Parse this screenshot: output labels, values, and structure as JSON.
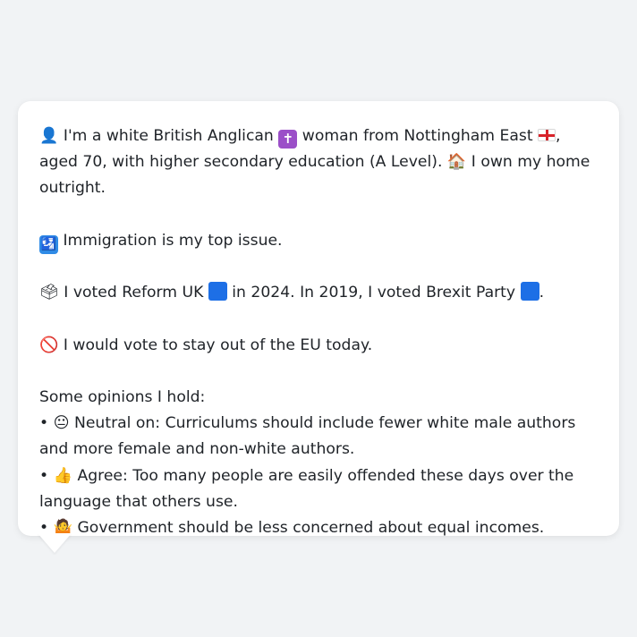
{
  "persona": {
    "intro": {
      "person_icon": "👤",
      "text1": "I'm a white British Anglican",
      "cross_icon": "✝",
      "text2": "woman from Nottingham East",
      "text3": ", aged 70, with higher secondary education (A Level).",
      "house_icon": "🏠",
      "text4": "I own my home outright."
    },
    "issue": {
      "icon": "🛂",
      "text": "Immigration is my top issue."
    },
    "vote": {
      "ballot_icon": "🗳",
      "text1": "I voted Reform UK",
      "text2": "in 2024. In 2019, I voted Brexit Party",
      "text3": "."
    },
    "eu": {
      "icon": "🚫",
      "text": "I would vote to stay out of the EU today."
    },
    "opinions": {
      "heading": "Some opinions I hold:",
      "bullet": "•",
      "items": [
        {
          "icon": "😐",
          "text": "Neutral on: Curriculums should include fewer white male authors and more female and non-white authors."
        },
        {
          "icon": "👍",
          "text": "Agree: Too many people are easily offended these days over the language that others use."
        },
        {
          "icon": "🤷",
          "text": "Government should be less concerned about equal incomes."
        }
      ]
    }
  },
  "colors": {
    "party_square": "#1d6fe6",
    "card_bg": "#ffffff",
    "page_bg": "#f1f3f5",
    "text": "#1f2328"
  },
  "icons": {
    "flag": "england-flag-icon",
    "party": "blue-square-icon"
  }
}
